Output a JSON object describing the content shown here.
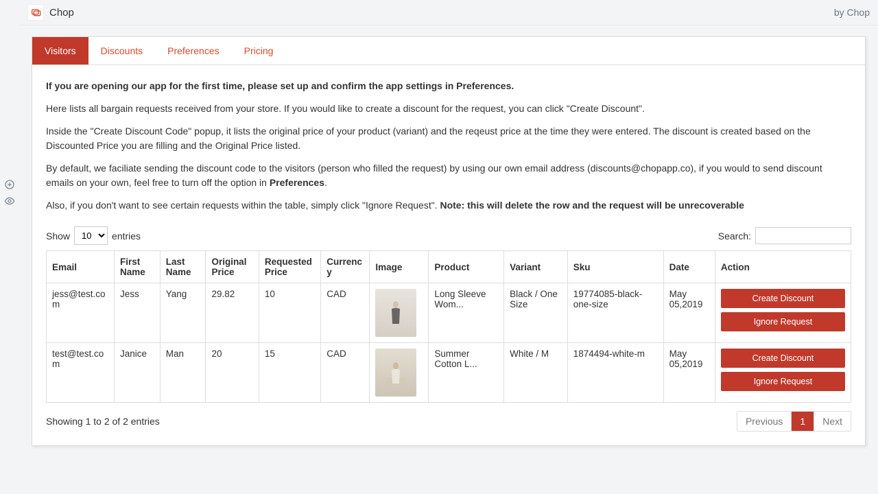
{
  "header": {
    "app_name": "Chop",
    "byline": "by Chop"
  },
  "tabs": {
    "visitors": "Visitors",
    "discounts": "Discounts",
    "preferences": "Preferences",
    "pricing": "Pricing"
  },
  "intro": {
    "p1_bold": "If you are opening our app for the first time, please set up and confirm the app settings in Preferences.",
    "p2": "Here lists all bargain requests received from your store. If you would like to create a discount for the request, you can click \"Create Discount\".",
    "p3": "Inside the \"Create Discount Code\" popup, it lists the original price of your product (variant) and the reqeust price at the time they were entered. The discount is created based on the Discounted Price you are filling and the Original Price listed.",
    "p4a": "By default, we faciliate sending the discount code to the visitors (person who filled the request) by using our own email address (discounts@chopapp.co), if you would to send discount emails on your own, feel free to turn off the option in ",
    "p4b_bold": "Preferences",
    "p4c": ".",
    "p5a": "Also, if you don't want to see certain requests within the table, simply click \"Ignore Request\". ",
    "p5b_bold": "Note: this will delete the row and the request will be unrecoverable"
  },
  "table_controls": {
    "show_label": "Show",
    "entries_label": "entries",
    "page_size": "10",
    "search_label": "Search:"
  },
  "columns": {
    "email": "Email",
    "first_name": "First Name",
    "last_name": "Last Name",
    "original_price": "Original Price",
    "requested_price": "Requested Price",
    "currency": "Currency",
    "image": "Image",
    "product": "Product",
    "variant": "Variant",
    "sku": "Sku",
    "date": "Date",
    "action": "Action"
  },
  "rows": [
    {
      "email": "jess@test.com",
      "first_name": "Jess",
      "last_name": "Yang",
      "original_price": "29.82",
      "requested_price": "10",
      "currency": "CAD",
      "product": "Long Sleeve Wom...",
      "variant": "Black / One Size",
      "sku": "19774085-black-one-size",
      "date": "May 05,2019"
    },
    {
      "email": "test@test.com",
      "first_name": "Janice",
      "last_name": "Man",
      "original_price": "20",
      "requested_price": "15",
      "currency": "CAD",
      "product": "Summer Cotton L...",
      "variant": "White / M",
      "sku": "1874494-white-m",
      "date": "May 05,2019"
    }
  ],
  "actions": {
    "create_discount": "Create Discount",
    "ignore_request": "Ignore Request"
  },
  "footer": {
    "info": "Showing 1 to 2 of 2 entries",
    "prev": "Previous",
    "page1": "1",
    "next": "Next"
  }
}
